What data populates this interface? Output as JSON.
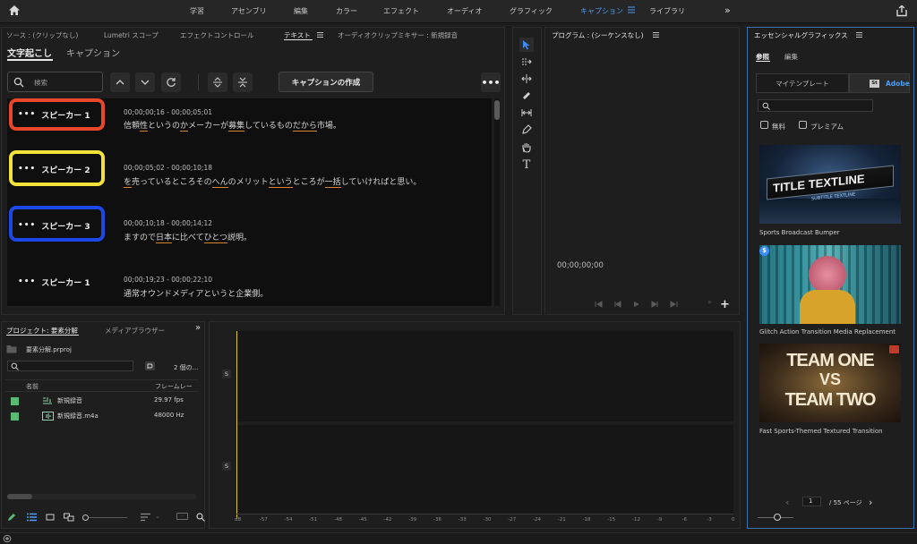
{
  "topbar": {
    "workspaces": [
      {
        "label": "学習"
      },
      {
        "label": "アセンブリ"
      },
      {
        "label": "編集"
      },
      {
        "label": "カラー"
      },
      {
        "label": "エフェクト"
      },
      {
        "label": "オーディオ"
      },
      {
        "label": "グラフィック"
      },
      {
        "label": "キャプション",
        "active": true
      },
      {
        "label": "ライブラリ"
      }
    ],
    "more": "»"
  },
  "source_tabs": [
    "ソース : (クリップなし)",
    "Lumetri スコープ",
    "エフェクトコントロール",
    "テキスト",
    "オーディオクリップミキサー : 新規録音"
  ],
  "text_panel": {
    "subtabs": [
      "文字起こし",
      "キャプション"
    ],
    "search_placeholder": "検索",
    "create_captions": "キャプションの作成",
    "entries": [
      {
        "speaker": "スピーカー 1",
        "timecode": "00;00;00;16 - 00;00;05;01",
        "ring_color": "#e8472a"
      },
      {
        "speaker": "スピーカー 2",
        "timecode": "00;00;05;02 - 00;00;10;18",
        "ring_color": "#f2e23a"
      },
      {
        "speaker": "スピーカー 3",
        "timecode": "00;00;10;18 - 00;00;14;12",
        "ring_color": "#1e47e8"
      },
      {
        "speaker": "スピーカー 1",
        "timecode": "00;00;19;23 - 00;00;22;10",
        "ring_color": null
      }
    ],
    "lines": {
      "l1": [
        "信頼",
        "性",
        "というの",
        "か",
        "メーカーが",
        "募集",
        "しているもの",
        "だから",
        "市場。"
      ],
      "l2": [
        "を",
        "売っているところその",
        "へん",
        "のメリット",
        "という",
        "ところが",
        "一括",
        "していければと思い。"
      ],
      "l3": [
        "ますので",
        "日本",
        "に比べて",
        "ひとつ",
        "説明。"
      ],
      "l4": "通常オウンドメディアというと企業側。"
    }
  },
  "program": {
    "title": "プログラム : (シーケンスなし)",
    "timecode": "00;00;00;00"
  },
  "project": {
    "tabs": [
      "プロジェクト: 要素分解",
      "メディアブラウザー"
    ],
    "file": "要素分解.prproj",
    "count": "2 個の...",
    "col_name": "名前",
    "col_rate": "フレームレー",
    "items": [
      {
        "name": "新規録音",
        "rate": "29.97 fps"
      },
      {
        "name": "新規録音.m4a",
        "rate": "48000 Hz"
      }
    ]
  },
  "meter": {
    "solo": "S",
    "scale": [
      "dB",
      "-57",
      "-54",
      "-51",
      "-48",
      "-45",
      "-42",
      "-39",
      "-36",
      "-33",
      "-30",
      "-27",
      "-24",
      "-21",
      "-18",
      "-15",
      "-12",
      "-9",
      "-6",
      "-3",
      "0"
    ]
  },
  "eg": {
    "title": "エッセンシャルグラフィックス",
    "tabs": [
      "参照",
      "編集"
    ],
    "source_tabs": [
      "マイテンプレート",
      "Adobe"
    ],
    "stock_badge": "St",
    "filters": [
      "無料",
      "プレミアム"
    ],
    "templates": [
      {
        "name": "Sports Broadcast Bumper",
        "thumb_title": "TITLE TEXTLINE",
        "thumb_sub": "SUBTITLE TEXTLINE"
      },
      {
        "name": "Glitch Action Transition Media Replacement"
      },
      {
        "name": "Fast Sports-Themed Textured Transition",
        "thumb_l1": "TEAM ONE",
        "thumb_l2": "VS",
        "thumb_l3": "TEAM TWO"
      }
    ],
    "page_current": "1",
    "page_total": "/ 55 ページ",
    "price_badge": "$"
  }
}
